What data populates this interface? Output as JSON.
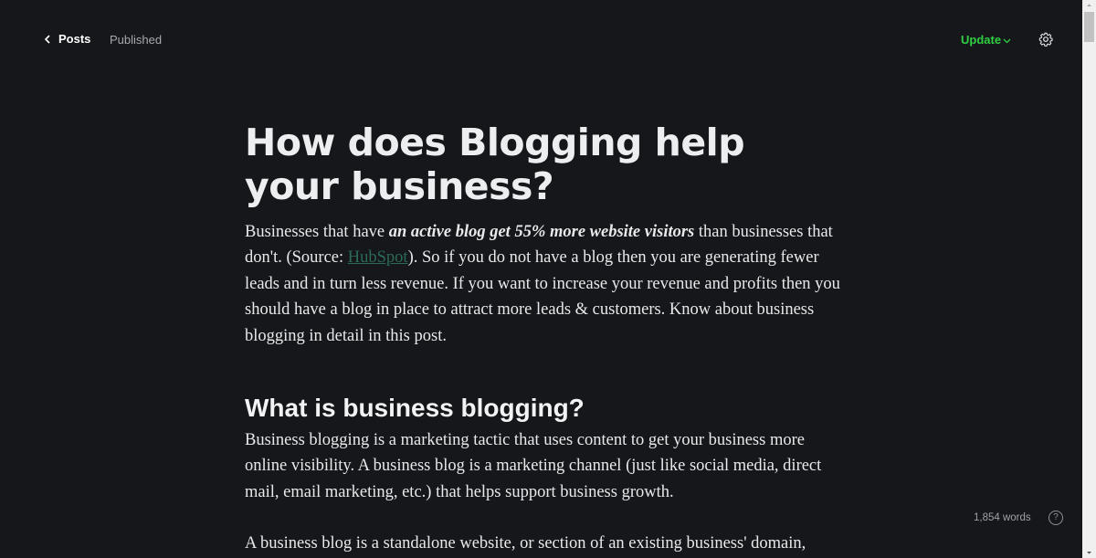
{
  "header": {
    "back_label": "Posts",
    "status": "Published",
    "update_label": "Update",
    "accent_color": "#30cf43"
  },
  "post": {
    "title": "How does Blogging help your business?",
    "intro": {
      "before": "Businesses that have ",
      "emphasis": "an active blog get 55% more website visitors",
      "middle": " than businesses that don't. (Source: ",
      "link_text": "HubSpot",
      "after": "). So if you do not have a blog then you are generating fewer leads and in turn less revenue. If you want to increase your revenue and profits then you should have a blog in place to attract more leads & customers. Know about business blogging in detail in this post."
    },
    "section_heading": "What is business blogging?",
    "section_paragraph_1": "Business blogging is a marketing tactic that uses content to get your business more online visibility. A business blog is a marketing channel (just like social media, direct mail, email marketing, etc.) that helps support business growth.",
    "section_paragraph_2": "A business blog is a standalone website, or section of an existing business' domain,"
  },
  "footer": {
    "word_count": "1,854 words",
    "help_glyph": "?"
  },
  "icons": {
    "back": "chevron-left-icon",
    "update_caret": "chevron-down-icon",
    "settings": "gear-icon",
    "help": "question-circle-icon"
  }
}
